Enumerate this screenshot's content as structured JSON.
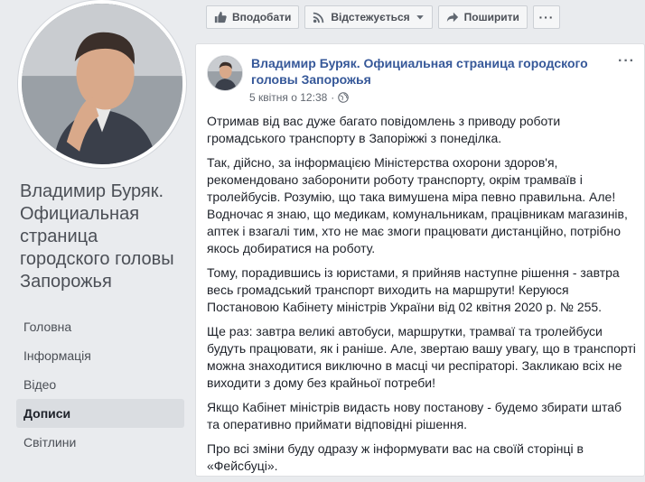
{
  "sidebar": {
    "page_name": "Владимир Буряк. Официальная страница городского головы Запорожья",
    "nav": [
      {
        "label": "Головна",
        "active": false
      },
      {
        "label": "Інформація",
        "active": false
      },
      {
        "label": "Відео",
        "active": false
      },
      {
        "label": "Дописи",
        "active": true
      },
      {
        "label": "Світлини",
        "active": false
      }
    ]
  },
  "actions": {
    "like": "Вподобати",
    "follow": "Відстежується",
    "share": "Поширити",
    "more": "···"
  },
  "post": {
    "author": "Владимир Буряк. Официальная страница городского головы Запорожья",
    "date": "5 квітня о 12:38",
    "privacy_icon": "globe-icon",
    "menu": "···",
    "paragraphs": [
      "Отримав від вас дуже багато повідомлень з приводу роботи громадського транспорту в Запоріжжі з понеділка.",
      "Так, дійсно, за інформацією Міністерства охорони здоров'я, рекомендовано заборонити роботу транспорту, окрім трамваїв і тролейбусів. Розумію, що така вимушена міра певно правильна. Але! Водночас я знаю, що медикам, комунальникам, працівникам магазинів, аптек і взагалі тим, хто не має змоги працювати дистанційно, потрібно якось добиратися на роботу.",
      "Тому, порадившись із юристами, я прийняв наступне рішення - завтра весь громадський транспорт виходить на маршрути! Керуюся Постановою Кабінету міністрів України від 02 квітня 2020 р. № 255.",
      "Ще раз: завтра великі автобуси, маршрутки, трамваї та тролейбуси будуть працювати, як і раніше. Але, звертаю вашу увагу, що в транспорті можна знаходитися виключно в масці чи респіраторі. Закликаю всіх не виходити з дому без крайньої потреби!",
      "Якщо Кабінет міністрів видасть нову постанову - будемо збирати штаб та оперативно приймати відповідні рішення.",
      "Про всі зміни буду одразу ж інформувати вас на своїй сторінці в «Фейсбуці»."
    ]
  },
  "colors": {
    "background": "#e9ebee",
    "link": "#365899",
    "active_nav": "#dadde1"
  }
}
